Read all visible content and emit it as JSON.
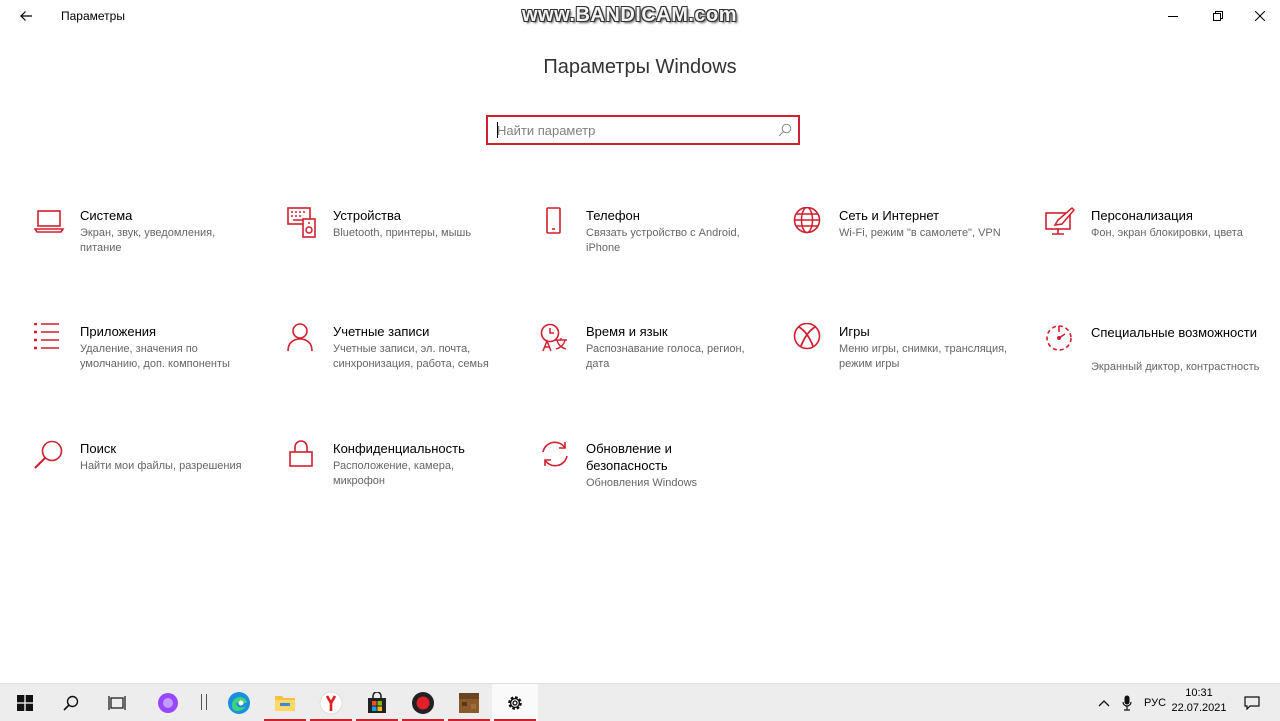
{
  "window": {
    "title": "Параметры",
    "back_icon": "arrow-left-icon",
    "controls": [
      "minimize-icon",
      "restore-icon",
      "close-icon"
    ]
  },
  "watermark": "www.BANDICAM.com",
  "header": {
    "title": "Параметры Windows"
  },
  "search": {
    "placeholder": "Найти параметр",
    "value": "",
    "icon": "search-icon"
  },
  "accent_color": "#d01f2e",
  "categories": [
    {
      "name": "Система",
      "desc": "Экран, звук, уведомления, питание",
      "icon": "laptop-icon"
    },
    {
      "name": "Устройства",
      "desc": "Bluetooth, принтеры, мышь",
      "icon": "devices-icon"
    },
    {
      "name": "Телефон",
      "desc": "Связать устройство с Android, iPhone",
      "icon": "phone-icon"
    },
    {
      "name": "Сеть и Интернет",
      "desc": "Wi-Fi, режим \"в самолете\", VPN",
      "icon": "globe-icon"
    },
    {
      "name": "Персонализация",
      "desc": "Фон, экран блокировки, цвета",
      "icon": "paint-icon"
    },
    {
      "name": "Приложения",
      "desc": "Удаление, значения по умолчанию, доп. компоненты",
      "icon": "apps-list-icon"
    },
    {
      "name": "Учетные записи",
      "desc": "Учетные записи, эл. почта, синхронизация, работа, семья",
      "icon": "person-icon"
    },
    {
      "name": "Время и язык",
      "desc": "Распознавание голоса, регион, дата",
      "icon": "time-language-icon"
    },
    {
      "name": "Игры",
      "desc": "Меню игры, снимки, трансляция, режим игры",
      "icon": "xbox-icon"
    },
    {
      "name": "Специальные возможности",
      "desc": "Экранный диктор, контрастность",
      "icon": "ease-of-access-icon"
    },
    {
      "name": "Поиск",
      "desc": "Найти мои файлы, разрешения",
      "icon": "search-icon"
    },
    {
      "name": "Конфиденциальность",
      "desc": "Расположение, камера, микрофон",
      "icon": "lock-icon"
    },
    {
      "name": "Обновление и безопасность",
      "desc": "Обновления Windows",
      "icon": "sync-icon"
    }
  ],
  "taskbar": {
    "items": [
      "windows-start-icon",
      "search-icon",
      "task-view-icon",
      "alice-icon",
      "edge-icon",
      "file-explorer-icon",
      "yandex-browser-icon",
      "store-icon",
      "bandicam-record-icon",
      "minecraft-icon",
      "settings-gear-icon"
    ],
    "tray": {
      "language": "РУС",
      "time": "10:31",
      "date": "22.07.2021"
    }
  }
}
